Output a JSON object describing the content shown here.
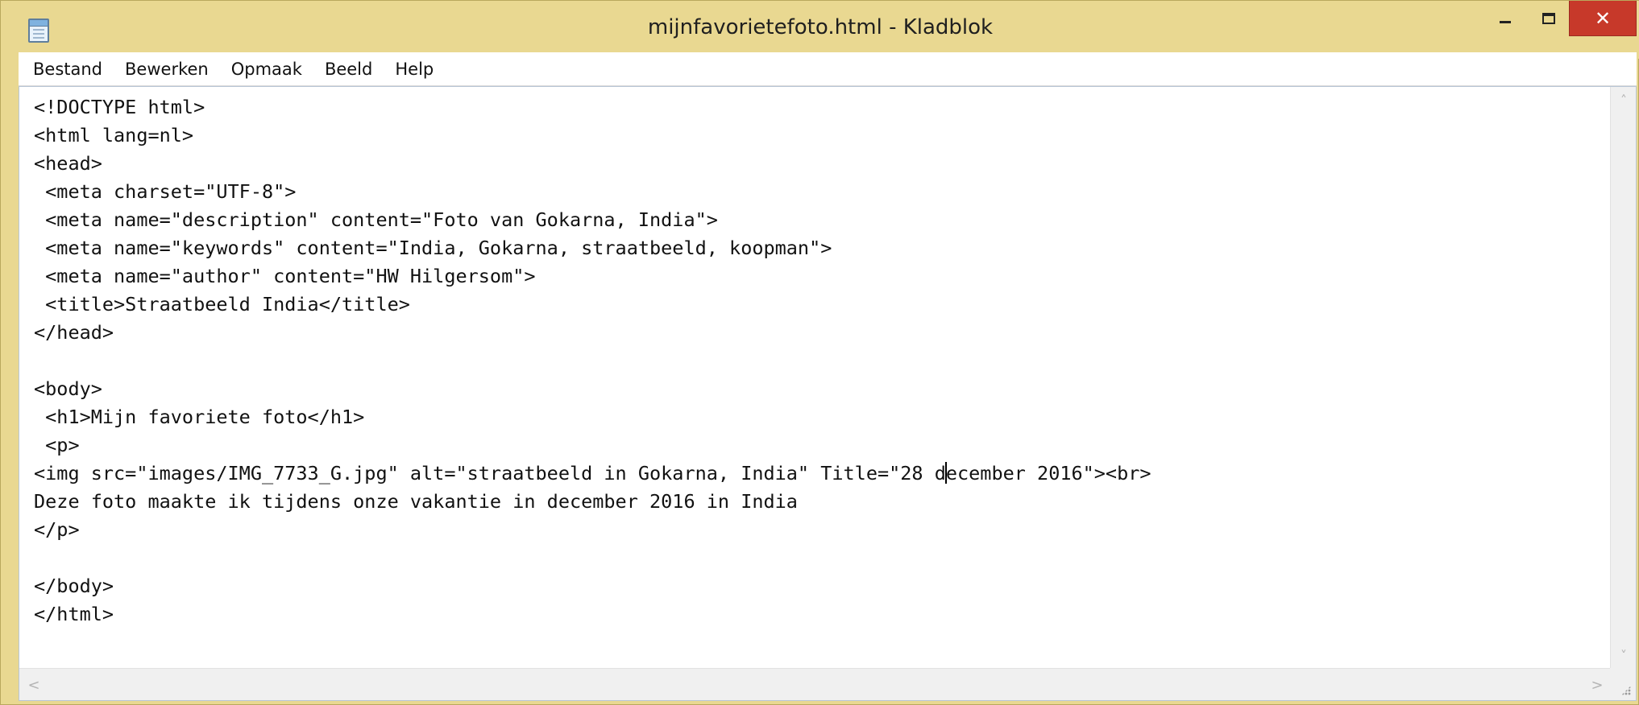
{
  "window": {
    "title": "mijnfavorietefoto.html - Kladblok",
    "app_icon": "notepad-icon",
    "controls": {
      "minimize_icon": "minimize-icon",
      "maximize_icon": "maximize-icon",
      "close_icon": "close-icon",
      "close_glyph": "✕"
    }
  },
  "menu": {
    "items": [
      "Bestand",
      "Bewerken",
      "Opmaak",
      "Beeld",
      "Help"
    ]
  },
  "editor": {
    "lines": [
      "<!DOCTYPE html>",
      "<html lang=nl>",
      "<head>",
      " <meta charset=\"UTF-8\">",
      " <meta name=\"description\" content=\"Foto van Gokarna, India\">",
      " <meta name=\"keywords\" content=\"India, Gokarna, straatbeeld, koopman\">",
      " <meta name=\"author\" content=\"HW Hilgersom\">",
      " <title>Straatbeeld India</title>",
      "</head>",
      "",
      "<body>",
      " <h1>Mijn favoriete foto</h1>",
      " <p>",
      "<img src=\"images/IMG_7733_G.jpg\" alt=\"straatbeeld in Gokarna, India\" Title=\"28 december 2016\"><br>",
      "Deze foto maakte ik tijdens onze vakantie in december 2016 in India",
      "</p>",
      "",
      "</body>",
      "</html>"
    ],
    "caret": {
      "line": 13,
      "column": 80
    }
  },
  "scrollbars": {
    "up_arrow": "˄",
    "down_arrow": "˅",
    "left_arrow": "<",
    "right_arrow": ">"
  },
  "colors": {
    "titlebar": "#e9d891",
    "close_button": "#c7392a",
    "text": "#111111"
  }
}
